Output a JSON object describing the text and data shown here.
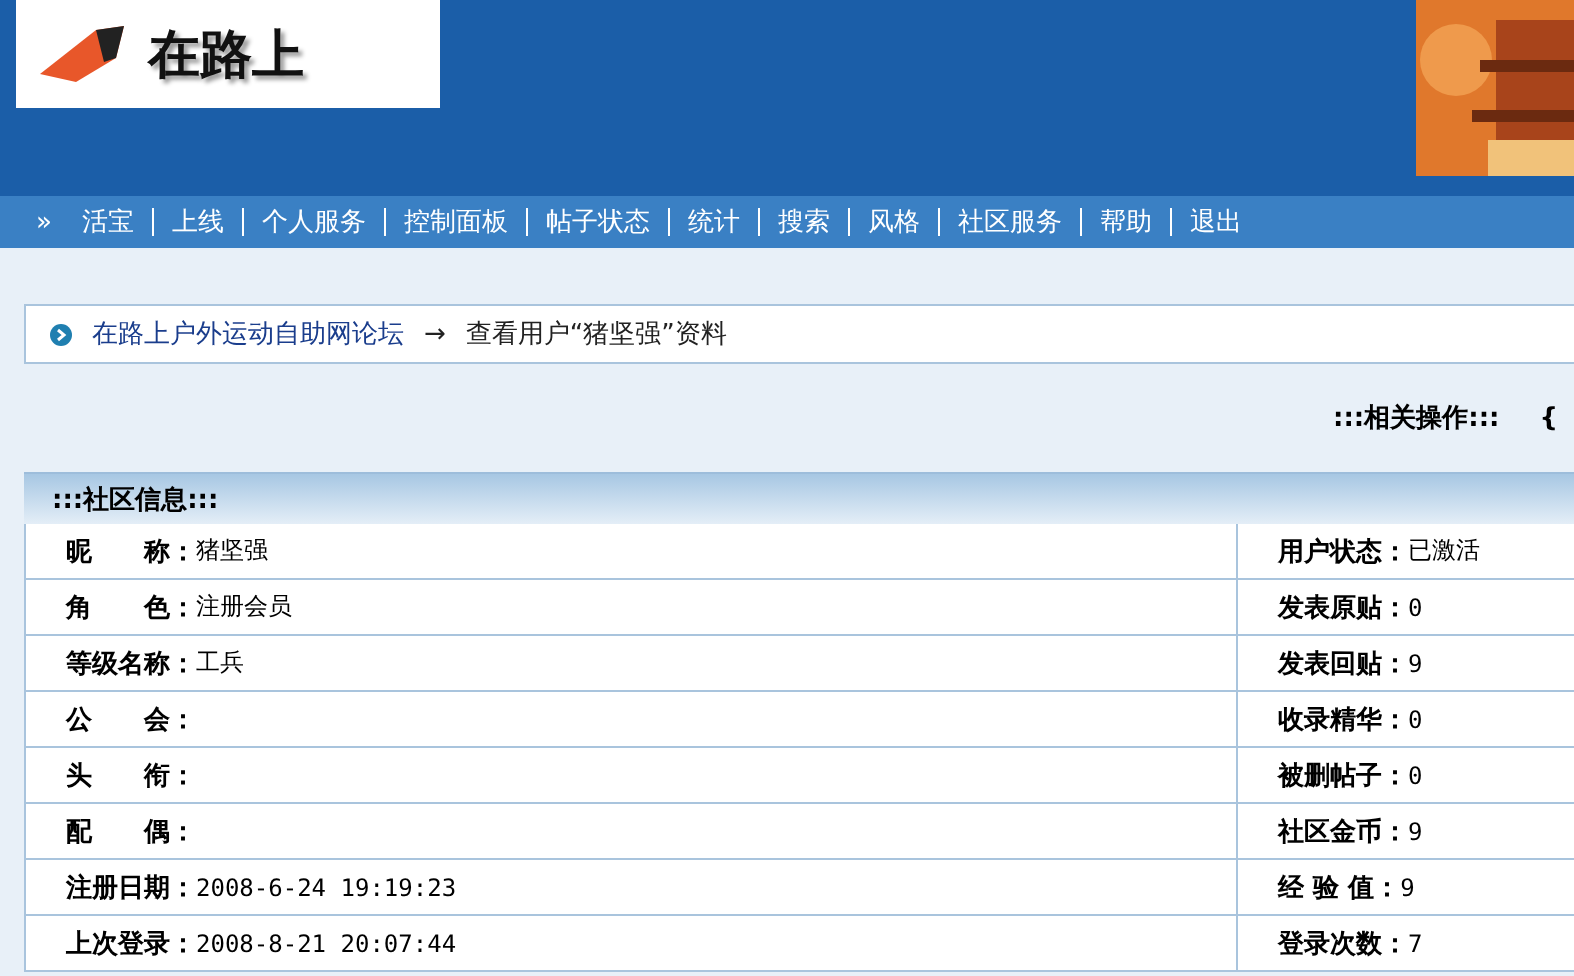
{
  "logo": {
    "text": "在路上"
  },
  "nav": {
    "marker": "»",
    "items": [
      "活宝",
      "上线",
      "个人服务",
      "控制面板",
      "帖子状态",
      "统计",
      "搜索",
      "风格",
      "社区服务",
      "帮助",
      "退出"
    ]
  },
  "breadcrumb": {
    "link": "在路上户外运动自助网论坛",
    "arrow": "→",
    "current": "查看用户“猪坚强”资料"
  },
  "actions": {
    "title": ":::相关操作:::",
    "extra": "{"
  },
  "section": {
    "title": ":::社区信息:::"
  },
  "rows": [
    {
      "left_label": "昵　　称：",
      "left_value": "猪坚强",
      "right_label": "用户状态：",
      "right_value": "已激活"
    },
    {
      "left_label": "角　　色：",
      "left_value": "注册会员",
      "right_label": "发表原贴：",
      "right_value": "0"
    },
    {
      "left_label": "等级名称：",
      "left_value": "工兵",
      "right_label": "发表回贴：",
      "right_value": "9"
    },
    {
      "left_label": "公　　会：",
      "right_label": "收录精华：",
      "right_value": "0"
    },
    {
      "left_label": "头　　衔：",
      "right_label": "被删帖子：",
      "right_value": "0"
    },
    {
      "left_label": "配　　偶：",
      "right_label": "社区金币：",
      "right_value": "9"
    },
    {
      "left_label": "注册日期：",
      "left_value": "2008-6-24 19:19:23",
      "right_label": "经 验 值：",
      "right_value": "9"
    },
    {
      "left_label": "上次登录：",
      "left_value": "2008-8-21 20:07:44",
      "right_label": "登录次数：",
      "right_value": "7"
    }
  ]
}
